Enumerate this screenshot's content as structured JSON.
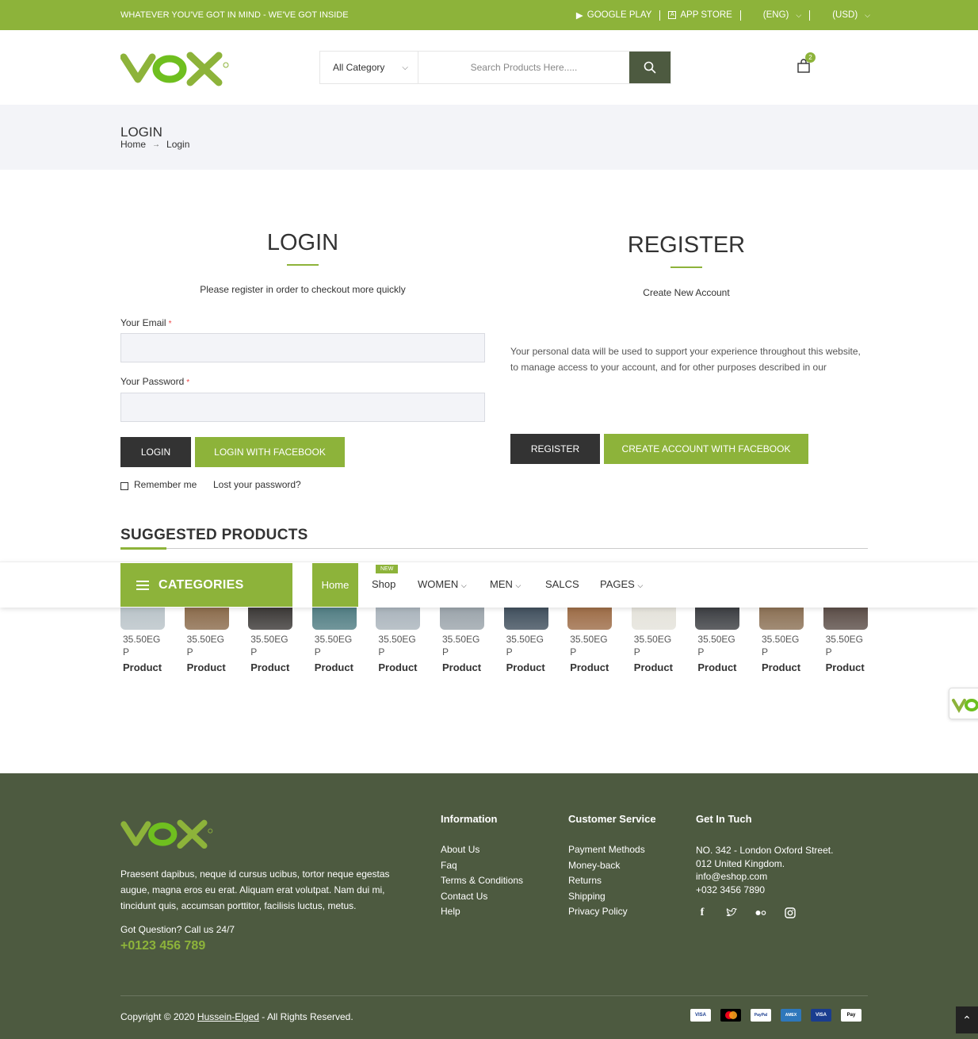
{
  "topbar": {
    "tagline": "WHATEVER YOU'VE GOT IN MIND - WE'VE GOT INSIDE",
    "google_play": "GOOGLE PLAY",
    "app_store": "APP STORE",
    "language": "(ENG)",
    "currency": "(USD)"
  },
  "header": {
    "category": "All Category",
    "search_placeholder": "Search Products Here.....",
    "cart_count": "2"
  },
  "breadcrumb": {
    "title": "LOGIN",
    "home": "Home",
    "current": "Login"
  },
  "login": {
    "title": "LOGIN",
    "subtitle": "Please register in order to checkout more quickly",
    "email_label": "Your Email",
    "password_label": "Your Password",
    "required_mark": "*",
    "login_button": "LOGIN",
    "facebook_button": "LOGIN WITH FACEBOOK",
    "remember": "Remember me",
    "lost_password": "Lost your password?"
  },
  "register": {
    "title": "REGISTER",
    "subtitle": "Create New Account",
    "privacy_text": "Your personal data will be used to support your experience throughout this website, to manage access to your account, and for other purposes described in our",
    "register_button": "REGISTER",
    "facebook_button": "CREATE ACCOUNT WITH FACEBOOK"
  },
  "suggested": {
    "title": "SUGGESTED PRODUCTS",
    "products": [
      {
        "price": "35.50EGP",
        "name": "Product",
        "color": "#b9c3c8"
      },
      {
        "price": "35.50EGP",
        "name": "Product",
        "color": "#8a6a4a"
      },
      {
        "price": "35.50EGP",
        "name": "Product",
        "color": "#3a3735"
      },
      {
        "price": "35.50EGP",
        "name": "Product",
        "color": "#4f7c82"
      },
      {
        "price": "35.50EGP",
        "name": "Product",
        "color": "#a9b3bb"
      },
      {
        "price": "35.50EGP",
        "name": "Product",
        "color": "#9aa3aa"
      },
      {
        "price": "35.50EGP",
        "name": "Product",
        "color": "#3f4e5c"
      },
      {
        "price": "35.50EGP",
        "name": "Product",
        "color": "#9c6b45"
      },
      {
        "price": "35.50EGP",
        "name": "Product",
        "color": "#e4e2da"
      },
      {
        "price": "35.50EGP",
        "name": "Product",
        "color": "#3a3c40"
      },
      {
        "price": "35.50EGP",
        "name": "Product",
        "color": "#8a6f53"
      },
      {
        "price": "35.50EGP",
        "name": "Product",
        "color": "#5a4c46"
      }
    ]
  },
  "nav": {
    "categories": "CATEGORIES",
    "home": "Home",
    "shop": "Shop",
    "new_badge": "NEW",
    "women": "WOMEN",
    "men": "MEN",
    "salcs": "SALCS",
    "pages": "PAGES"
  },
  "footer": {
    "about": "Praesent dapibus, neque id cursus ucibus, tortor neque egestas augue, magna eros eu erat. Aliquam erat volutpat. Nam dui mi, tincidunt quis, accumsan porttitor, facilisis luctus, metus.",
    "question": "Got Question? Call us 24/7",
    "phone": "+0123 456 789",
    "information_title": "Information",
    "information": [
      "About Us",
      "Faq",
      "Terms & Conditions",
      "Contact Us",
      "Help"
    ],
    "service_title": "Customer Service",
    "service": [
      "Payment Methods",
      "Money-back",
      "Returns",
      "Shipping",
      "Privacy Policy"
    ],
    "contact_title": "Get In Tuch",
    "address1": "NO. 342 - London Oxford Street.",
    "address2": "012 United Kingdom.",
    "email": "info@eshop.com",
    "tel": "+032 3456 7890",
    "copyright_prefix": "Copyright © 2020 ",
    "copyright_link": "Hussein-Elged",
    "copyright_suffix": " - All Rights Reserved.",
    "payments": [
      "VISA",
      "MC",
      "PayPal",
      "AMEX",
      "VISA",
      "Pay"
    ]
  },
  "colors": {
    "brand_green": "#8db33a",
    "footer_bg": "#4d5a40",
    "dark_button": "#333333"
  }
}
